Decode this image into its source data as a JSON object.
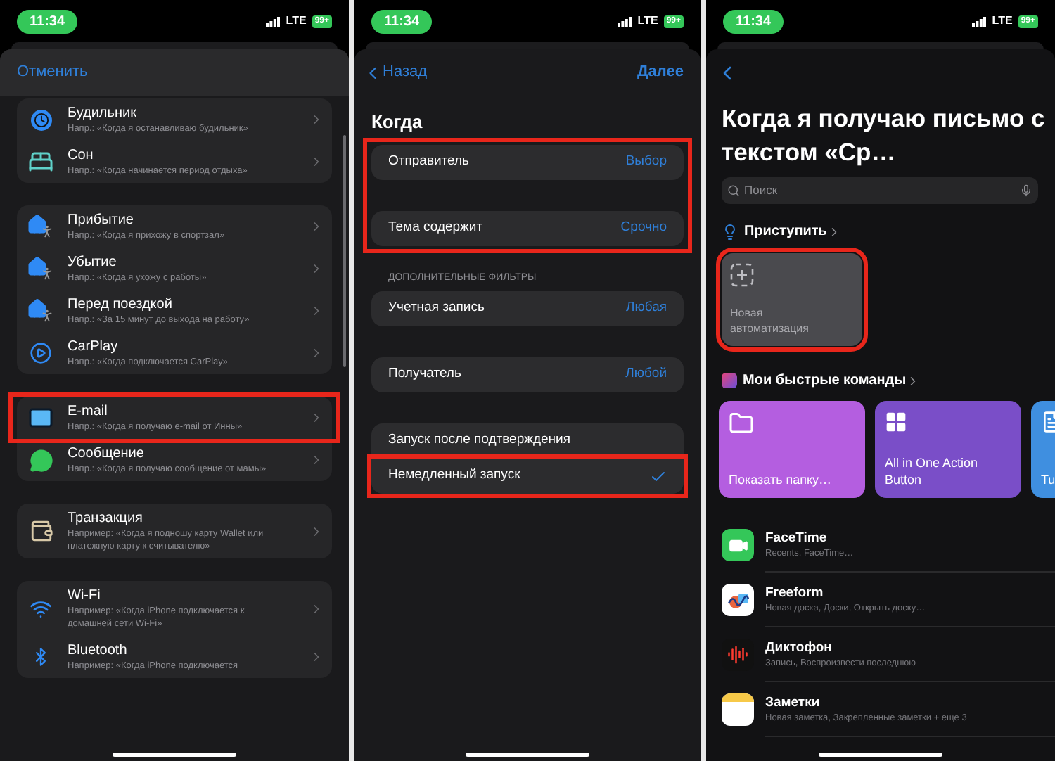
{
  "trigger_list_screen": {
    "status": {
      "time": "11:34",
      "network": "LTE",
      "battery": "99+"
    },
    "cancel": "Отменить",
    "groups": [
      {
        "items": [
          {
            "title": "Будильник",
            "subtitle": "Напр.: «Когда я останавливаю будильник»",
            "highlighted": false
          },
          {
            "title": "Сон",
            "subtitle": "Напр.: «Когда начинается период отдыха»",
            "highlighted": false
          }
        ]
      },
      {
        "items": [
          {
            "title": "Прибытие",
            "subtitle": "Напр.: «Когда я прихожу в спортзал»",
            "highlighted": false
          },
          {
            "title": "Убытие",
            "subtitle": "Напр.: «Когда я ухожу с работы»",
            "highlighted": false
          },
          {
            "title": "Перед поездкой",
            "subtitle": "Напр.: «За 15 минут до выхода на работу»",
            "highlighted": false
          },
          {
            "title": "CarPlay",
            "subtitle": "Напр.: «Когда подключается CarPlay»",
            "highlighted": false
          }
        ]
      },
      {
        "items": [
          {
            "title": "E-mail",
            "subtitle": "Напр.: «Когда я получаю e-mail от Инны»",
            "highlighted": true
          },
          {
            "title": "Сообщение",
            "subtitle": "Напр.: «Когда я получаю сообщение от мамы»",
            "highlighted": false
          }
        ]
      },
      {
        "items": [
          {
            "title": "Транзакция",
            "subtitle": "Например: «Когда я подношу карту Wallet или платежную карту к считывателю»",
            "highlighted": false
          }
        ]
      },
      {
        "items": [
          {
            "title": "Wi-Fi",
            "subtitle": "Например: «Когда iPhone подключается к домашней сети Wi-Fi»",
            "highlighted": false
          },
          {
            "title": "Bluetooth",
            "subtitle": "Например: «Когда iPhone подключается",
            "highlighted": false
          }
        ]
      }
    ]
  },
  "email_trigger_screen": {
    "status": {
      "time": "11:34",
      "network": "LTE",
      "battery": "99+"
    },
    "back": "Назад",
    "next": "Далее",
    "heading": "Когда",
    "main_group": {
      "highlighted": true,
      "rows": [
        {
          "label": "Отправитель",
          "value": "Выбор"
        },
        {
          "label": "Тема содержит",
          "value": "Срочно"
        }
      ]
    },
    "filters_header": "ДОПОЛНИТЕЛЬНЫЕ ФИЛЬТРЫ",
    "filter_rows": [
      {
        "label": "Учетная запись",
        "value": "Любая"
      },
      {
        "label": "Получатель",
        "value": "Любой"
      }
    ],
    "launch_options": [
      {
        "label": "Запуск после подтверждения",
        "selected": false,
        "highlighted": false
      },
      {
        "label": "Немедленный запуск",
        "selected": true,
        "highlighted": true
      }
    ]
  },
  "automation_screen": {
    "status": {
      "time": "11:34",
      "network": "LTE",
      "battery": "99+"
    },
    "title": "Когда я получаю письмо с текстом «Ср…",
    "search": {
      "placeholder": "Поиск"
    },
    "get_started": "Приступить",
    "new_automation": {
      "label": "Новая автоматизация",
      "highlighted": true
    },
    "my_shortcuts": "Мои быстрые команды",
    "shortcuts": [
      {
        "label": "Показать папку…",
        "color": "#b45ee0"
      },
      {
        "label": "All in One Action Button",
        "color": "#7a4ec8"
      },
      {
        "label": "Tu",
        "color": "#3f8fe0"
      }
    ],
    "apps": [
      {
        "name": "FaceTime",
        "actions": "Recents, FaceTime…"
      },
      {
        "name": "Freeform",
        "actions": "Новая доска, Доски, Открыть доску…"
      },
      {
        "name": "Диктофон",
        "actions": "Запись, Воспроизвести последнюю"
      },
      {
        "name": "Заметки",
        "actions": "Новая заметка, Закрепленные заметки + еще 3"
      }
    ]
  }
}
